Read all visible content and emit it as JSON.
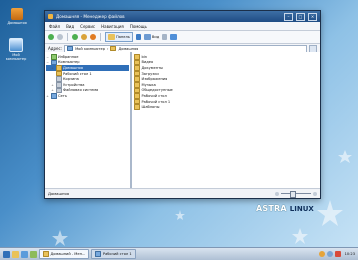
{
  "desktop": {
    "icons": [
      {
        "label": "Домашняя"
      },
      {
        "label": "Мой компьютер"
      }
    ],
    "brand": {
      "astra": "ASTRA",
      "linux": "LINUX"
    }
  },
  "window": {
    "title": "Домашняя - Менеджер файлов",
    "controls": {
      "min": "–",
      "max": "□",
      "close": "×"
    },
    "menu": [
      "Файл",
      "Вид",
      "Сервис",
      "Навигация",
      "Помощь"
    ],
    "toolbar": {
      "panel_label": "Панель",
      "view_label": "Вид"
    },
    "address": {
      "label": "Адрес:",
      "path": [
        "Мой компьютер",
        "Домашняя"
      ]
    },
    "tree": [
      {
        "label": "Избранное",
        "icon": "star-icon",
        "exp": "−",
        "indent": 0,
        "selected": false
      },
      {
        "label": "Компьютер",
        "icon": "computer-icon",
        "exp": "−",
        "indent": 0,
        "selected": false
      },
      {
        "label": "Домашняя",
        "icon": "folder-icon",
        "exp": "+",
        "indent": 1,
        "selected": true
      },
      {
        "label": "Рабочий стол 1",
        "icon": "folder-icon",
        "exp": "",
        "indent": 1,
        "selected": false
      },
      {
        "label": "Корзина",
        "icon": "trash-icon",
        "exp": "",
        "indent": 1,
        "selected": false
      },
      {
        "label": "Устройства",
        "icon": "device-icon",
        "exp": "+",
        "indent": 1,
        "selected": false
      },
      {
        "label": "Файловая система",
        "icon": "drive-icon",
        "exp": "+",
        "indent": 1,
        "selected": false
      },
      {
        "label": "Сеть",
        "icon": "network-icon",
        "exp": "+",
        "indent": 0,
        "selected": false
      }
    ],
    "files": [
      {
        "label": "bin",
        "icon": "folder-icon"
      },
      {
        "label": "Видео",
        "icon": "folder-icon"
      },
      {
        "label": "Документы",
        "icon": "folder-icon"
      },
      {
        "label": "Загрузки",
        "icon": "folder-icon"
      },
      {
        "label": "Изображения",
        "icon": "folder-icon"
      },
      {
        "label": "Музыка",
        "icon": "folder-icon"
      },
      {
        "label": "Общедоступные",
        "icon": "folder-icon"
      },
      {
        "label": "Рабочий стол",
        "icon": "folder-icon"
      },
      {
        "label": "Рабочий стол 1",
        "icon": "folder-icon"
      },
      {
        "label": "Шаблоны",
        "icon": "folder-icon"
      }
    ],
    "status": {
      "left": "Домашняя"
    },
    "zoom_level": 0.35
  },
  "taskbar": {
    "tasks": [
      {
        "label": "Домашний - Мен...",
        "active": true
      },
      {
        "label": "Рабочий стол 1",
        "active": false
      }
    ],
    "clock": "10:23"
  }
}
